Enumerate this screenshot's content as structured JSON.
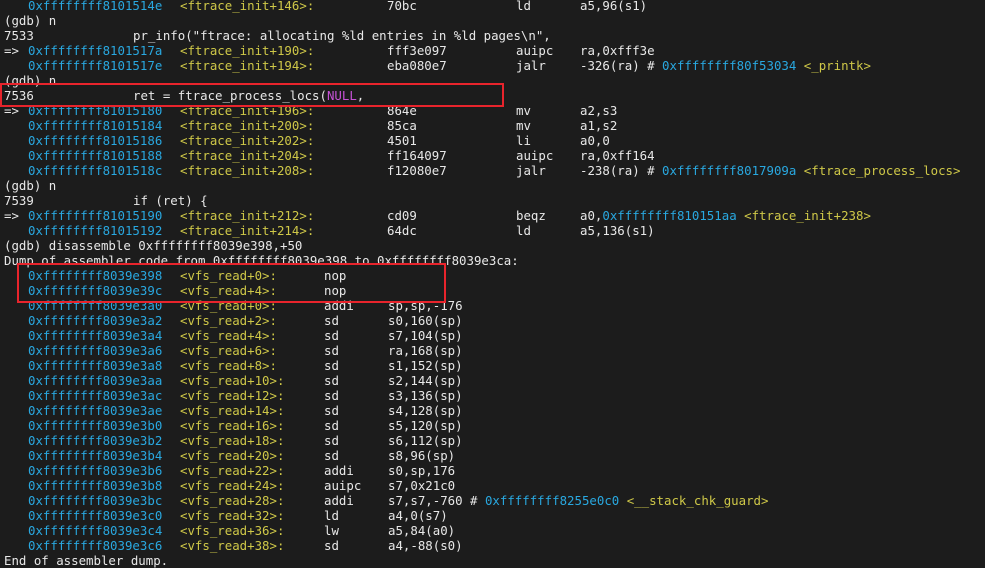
{
  "colors": {
    "background": "#1c1c1c",
    "text": "#e8e8e8",
    "address": "#29a8e0",
    "symbol": "#cfc848",
    "keyword": "#c652d6",
    "highlight_box": "#e8242c"
  },
  "lines": [
    {
      "kind": "asm",
      "prefix": "   ",
      "addr": "0xffffffff8101514e",
      "sym": "<ftrace_init+146>:",
      "op": "70bc",
      "mn": "ld",
      "args": "a5,96(s1)"
    },
    {
      "kind": "text",
      "text": "(gdb) n"
    },
    {
      "kind": "src",
      "num": "7533",
      "code": "pr_info(\"ftrace: allocating %ld entries in %ld pages\\n\","
    },
    {
      "kind": "asm",
      "prefix": "=> ",
      "addr": "0xffffffff8101517a",
      "sym": "<ftrace_init+190>:",
      "op": "fff3e097",
      "mn": "auipc",
      "args": "ra,0xfff3e"
    },
    {
      "kind": "asm",
      "prefix": "   ",
      "addr": "0xffffffff8101517e",
      "sym": "<ftrace_init+194>:",
      "op": "eba080e7",
      "mn": "jalr",
      "args": "-326(ra) # ",
      "taddr": "0xffffffff80f53034",
      "tsym": "<_printk>"
    },
    {
      "kind": "text",
      "text": "(gdb) n"
    },
    {
      "kind": "src",
      "num": "7536",
      "code": "ret = ftrace_process_locs(",
      "kw": "NULL",
      "after": ","
    },
    {
      "kind": "asm",
      "prefix": "=> ",
      "addr": "0xffffffff81015180",
      "sym": "<ftrace_init+196>:",
      "op": "864e",
      "mn": "mv",
      "args": "a2,s3"
    },
    {
      "kind": "asm",
      "prefix": "   ",
      "addr": "0xffffffff81015184",
      "sym": "<ftrace_init+200>:",
      "op": "85ca",
      "mn": "mv",
      "args": "a1,s2"
    },
    {
      "kind": "asm",
      "prefix": "   ",
      "addr": "0xffffffff81015186",
      "sym": "<ftrace_init+202>:",
      "op": "4501",
      "mn": "li",
      "args": "a0,0"
    },
    {
      "kind": "asm",
      "prefix": "   ",
      "addr": "0xffffffff81015188",
      "sym": "<ftrace_init+204>:",
      "op": "ff164097",
      "mn": "auipc",
      "args": "ra,0xff164"
    },
    {
      "kind": "asm",
      "prefix": "   ",
      "addr": "0xffffffff8101518c",
      "sym": "<ftrace_init+208>:",
      "op": "f12080e7",
      "mn": "jalr",
      "args": "-238(ra) # ",
      "taddr": "0xffffffff8017909a",
      "tsym": "<ftrace_process_locs>"
    },
    {
      "kind": "text",
      "text": "(gdb) n"
    },
    {
      "kind": "src",
      "num": "7539",
      "code": "if (ret) {"
    },
    {
      "kind": "asm",
      "prefix": "=> ",
      "addr": "0xffffffff81015190",
      "sym": "<ftrace_init+212>:",
      "op": "cd09",
      "mn": "beqz",
      "args": "a0,",
      "taddr": "0xffffffff810151aa",
      "tsym": "<ftrace_init+238>"
    },
    {
      "kind": "asm",
      "prefix": "   ",
      "addr": "0xffffffff81015192",
      "sym": "<ftrace_init+214>:",
      "op": "64dc",
      "mn": "ld",
      "args": "a5,136(s1)"
    },
    {
      "kind": "text",
      "text": "(gdb) disassemble 0xffffffff8039e398,+50"
    },
    {
      "kind": "text",
      "text": "Dump of assembler code from 0xffffffff8039e398 to 0xffffffff8039e3ca:"
    },
    {
      "kind": "dis",
      "addr": "0xffffffff8039e398",
      "sym": "<vfs_read+0>:",
      "mn": "nop",
      "args": ""
    },
    {
      "kind": "dis",
      "addr": "0xffffffff8039e39c",
      "sym": "<vfs_read+4>:",
      "mn": "nop",
      "args": ""
    },
    {
      "kind": "dis",
      "addr": "0xffffffff8039e3a0",
      "sym": "<vfs_read+0>:",
      "mn": "addi",
      "args": "sp,sp,-176"
    },
    {
      "kind": "dis",
      "addr": "0xffffffff8039e3a2",
      "sym": "<vfs_read+2>:",
      "mn": "sd",
      "args": "s0,160(sp)"
    },
    {
      "kind": "dis",
      "addr": "0xffffffff8039e3a4",
      "sym": "<vfs_read+4>:",
      "mn": "sd",
      "args": "s7,104(sp)"
    },
    {
      "kind": "dis",
      "addr": "0xffffffff8039e3a6",
      "sym": "<vfs_read+6>:",
      "mn": "sd",
      "args": "ra,168(sp)"
    },
    {
      "kind": "dis",
      "addr": "0xffffffff8039e3a8",
      "sym": "<vfs_read+8>:",
      "mn": "sd",
      "args": "s1,152(sp)"
    },
    {
      "kind": "dis",
      "addr": "0xffffffff8039e3aa",
      "sym": "<vfs_read+10>:",
      "mn": "sd",
      "args": "s2,144(sp)"
    },
    {
      "kind": "dis",
      "addr": "0xffffffff8039e3ac",
      "sym": "<vfs_read+12>:",
      "mn": "sd",
      "args": "s3,136(sp)"
    },
    {
      "kind": "dis",
      "addr": "0xffffffff8039e3ae",
      "sym": "<vfs_read+14>:",
      "mn": "sd",
      "args": "s4,128(sp)"
    },
    {
      "kind": "dis",
      "addr": "0xffffffff8039e3b0",
      "sym": "<vfs_read+16>:",
      "mn": "sd",
      "args": "s5,120(sp)"
    },
    {
      "kind": "dis",
      "addr": "0xffffffff8039e3b2",
      "sym": "<vfs_read+18>:",
      "mn": "sd",
      "args": "s6,112(sp)"
    },
    {
      "kind": "dis",
      "addr": "0xffffffff8039e3b4",
      "sym": "<vfs_read+20>:",
      "mn": "sd",
      "args": "s8,96(sp)"
    },
    {
      "kind": "dis",
      "addr": "0xffffffff8039e3b6",
      "sym": "<vfs_read+22>:",
      "mn": "addi",
      "args": "s0,sp,176"
    },
    {
      "kind": "dis",
      "addr": "0xffffffff8039e3b8",
      "sym": "<vfs_read+24>:",
      "mn": "auipc",
      "args": "s7,0x21c0"
    },
    {
      "kind": "dis",
      "addr": "0xffffffff8039e3bc",
      "sym": "<vfs_read+28>:",
      "mn": "addi",
      "args": "s7,s7,-760 # ",
      "taddr": "0xffffffff8255e0c0",
      "tsym": "<__stack_chk_guard>"
    },
    {
      "kind": "dis",
      "addr": "0xffffffff8039e3c0",
      "sym": "<vfs_read+32>:",
      "mn": "ld",
      "args": "a4,0(s7)"
    },
    {
      "kind": "dis",
      "addr": "0xffffffff8039e3c4",
      "sym": "<vfs_read+36>:",
      "mn": "lw",
      "args": "a5,84(a0)"
    },
    {
      "kind": "dis",
      "addr": "0xffffffff8039e3c6",
      "sym": "<vfs_read+38>:",
      "mn": "sd",
      "args": "a4,-88(s0)"
    },
    {
      "kind": "text",
      "text": "End of assembler dump."
    }
  ]
}
